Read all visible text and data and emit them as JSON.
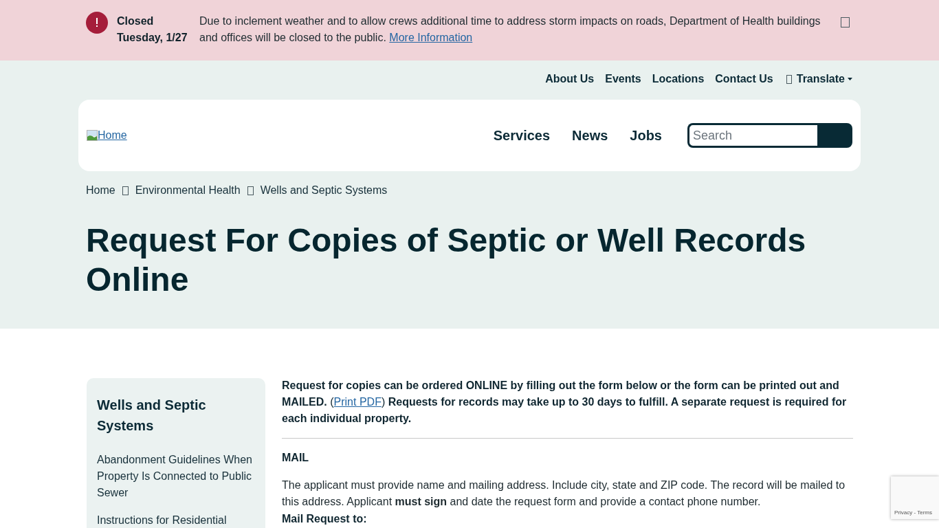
{
  "alert": {
    "title": "Closed",
    "date": "Tuesday, 1/27",
    "message": "Due to inclement weather and to allow crews additional time to address storm impacts on roads, Department of Health buildings and offices will be closed to the public.",
    "link": "More Information"
  },
  "utility_nav": {
    "items": [
      "About Us",
      "Events",
      "Locations",
      "Contact Us"
    ],
    "translate": "Translate"
  },
  "header": {
    "logo_alt": "Home",
    "nav": [
      "Services",
      "News",
      "Jobs"
    ],
    "search": {
      "placeholder": "Search"
    }
  },
  "breadcrumb": [
    "Home",
    "Environmental Health",
    "Wells and Septic Systems"
  ],
  "page_title": "Request For Copies of Septic or Well Records Online",
  "sidebar": {
    "title": "Wells and Septic Systems",
    "items": [
      "Abandonment Guidelines When Property Is Connected to Public Sewer",
      "Instructions for Residential"
    ]
  },
  "content": {
    "intro_before": "**Request for copies can be ordered ONLINE by filling out the form below or the form can be printed out and MAILED.** (",
    "intro_link": "Print PDF",
    "intro_after": ") **Requests for records may take up to 30 days to fulfill. A separate request is required for each individual property.**",
    "sections": [
      {
        "heading": "MAIL",
        "body": "The applicant must provide name and mailing address. Include city, state and ZIP code. The record will be mailed to this address. Applicant **must sign** and date the request form and provide a contact phone number.",
        "subheading": "Mail Request to:"
      }
    ]
  },
  "recaptcha": {
    "links": "Privacy - Terms"
  }
}
